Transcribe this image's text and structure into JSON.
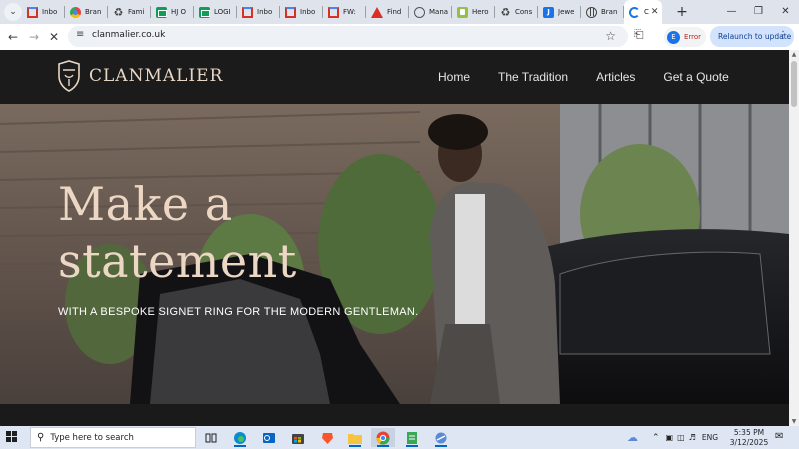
{
  "browser": {
    "tabs": [
      {
        "title": "Inbo",
        "icon": "gmail-icon"
      },
      {
        "title": "Bran",
        "icon": "chrome-icon"
      },
      {
        "title": "Fami",
        "icon": "crest-icon"
      },
      {
        "title": "HJ O",
        "icon": "sheets-icon"
      },
      {
        "title": "LOGI",
        "icon": "sheets-icon"
      },
      {
        "title": "Inbo",
        "icon": "gmail-icon"
      },
      {
        "title": "Inbo",
        "icon": "gmail-icon"
      },
      {
        "title": "FW: ",
        "icon": "gmail-icon"
      },
      {
        "title": "Find",
        "icon": "warning-icon"
      },
      {
        "title": "Mana",
        "icon": "circle-icon"
      },
      {
        "title": "Hero",
        "icon": "shopify-icon"
      },
      {
        "title": "Cons",
        "icon": "crest-icon"
      },
      {
        "title": "Jewe",
        "icon": "jw-icon"
      },
      {
        "title": "Bran",
        "icon": "globe-icon"
      },
      {
        "title": "C",
        "icon": "loading-icon",
        "active": true
      }
    ],
    "new_tab": "+",
    "address": "clanmalier.co.uk",
    "profile_initial": "E",
    "profile_status": "Error",
    "relaunch_label": "Relaunch to update"
  },
  "site": {
    "logo": "CLANMALIER",
    "nav": [
      "Home",
      "The Tradition",
      "Articles",
      "Get a Quote"
    ],
    "hero": {
      "title_line1": "Make a",
      "title_line2": "statement",
      "subtitle": "WITH A BESPOKE SIGNET RING FOR THE MODERN GENTLEMAN."
    }
  },
  "taskbar": {
    "search_placeholder": "Type here to search",
    "language": "ENG",
    "time": "5:35 PM",
    "date": "3/12/2025"
  },
  "colors": {
    "header_bg": "#1b1b1b",
    "hero_title": "#ecd7c5",
    "logo": "#e8d6c4",
    "relaunch_bg": "#d3e3fd"
  }
}
